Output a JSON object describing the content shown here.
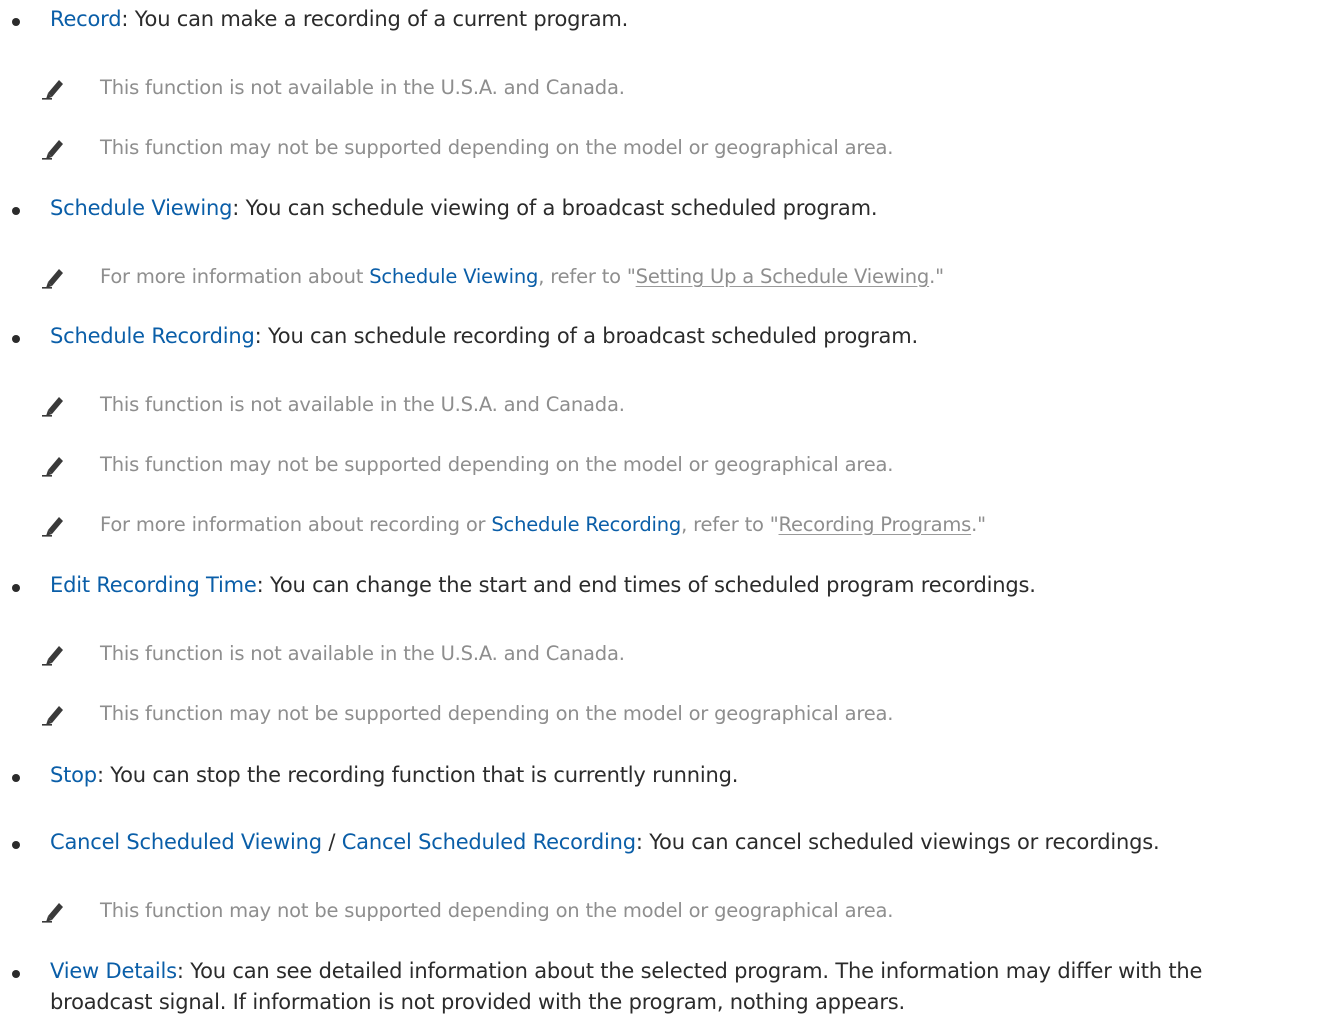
{
  "colors": {
    "text": "#2b2b2b",
    "link": "#0a5ea8",
    "note": "#8e8e8e"
  },
  "note_icon": "pencil-icon",
  "items": [
    {
      "terms": [
        "Record"
      ],
      "desc": ": You can make a recording of a current program."
    },
    {
      "terms": [
        "Schedule Viewing"
      ],
      "desc": ": You can schedule viewing of a broadcast scheduled program."
    },
    {
      "terms": [
        "Schedule Recording"
      ],
      "desc": ": You can schedule recording of a broadcast scheduled program."
    },
    {
      "terms": [
        "Edit Recording Time"
      ],
      "desc": ": You can change the start and end times of scheduled program recordings."
    },
    {
      "terms": [
        "Stop"
      ],
      "desc": ": You can stop the recording function that is currently running."
    },
    {
      "terms": [
        "Cancel Scheduled Viewing",
        "/",
        "Cancel Scheduled Recording"
      ],
      "desc": ": You can cancel scheduled viewings or recordings."
    },
    {
      "terms": [
        "View Details"
      ],
      "desc": ": You can see detailed information about the selected program. The information may differ with the broadcast signal. If information is not provided with the program, nothing appears."
    }
  ],
  "notes": {
    "not_available": "This function is not available in the U.S.A. and Canada.",
    "may_not_supported": "This function may not be supported depending on the model or geographical area.",
    "schedule_viewing_info": {
      "pre": "For more information about ",
      "strong": "Schedule Viewing",
      "mid": ", refer to \"",
      "link": "Setting Up a Schedule Viewing",
      "post": ".\""
    },
    "recording_info": {
      "pre": "For more information about recording or ",
      "strong": "Schedule Recording",
      "mid": ", refer to \"",
      "link": "Recording Programs",
      "post": ".\""
    }
  }
}
